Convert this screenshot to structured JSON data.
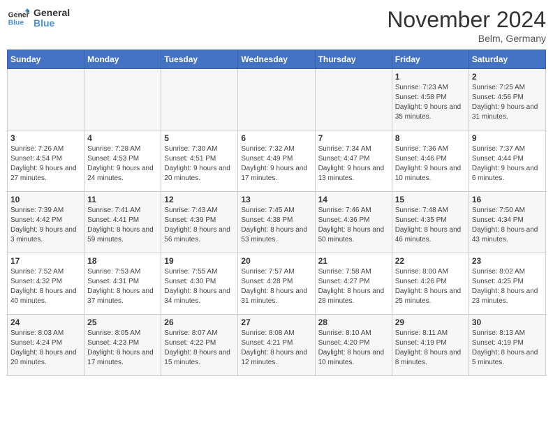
{
  "header": {
    "logo_line1": "General",
    "logo_line2": "Blue",
    "month_title": "November 2024",
    "location": "Belm, Germany"
  },
  "weekdays": [
    "Sunday",
    "Monday",
    "Tuesday",
    "Wednesday",
    "Thursday",
    "Friday",
    "Saturday"
  ],
  "weeks": [
    [
      {
        "day": "",
        "info": ""
      },
      {
        "day": "",
        "info": ""
      },
      {
        "day": "",
        "info": ""
      },
      {
        "day": "",
        "info": ""
      },
      {
        "day": "",
        "info": ""
      },
      {
        "day": "1",
        "info": "Sunrise: 7:23 AM\nSunset: 4:58 PM\nDaylight: 9 hours and 35 minutes."
      },
      {
        "day": "2",
        "info": "Sunrise: 7:25 AM\nSunset: 4:56 PM\nDaylight: 9 hours and 31 minutes."
      }
    ],
    [
      {
        "day": "3",
        "info": "Sunrise: 7:26 AM\nSunset: 4:54 PM\nDaylight: 9 hours and 27 minutes."
      },
      {
        "day": "4",
        "info": "Sunrise: 7:28 AM\nSunset: 4:53 PM\nDaylight: 9 hours and 24 minutes."
      },
      {
        "day": "5",
        "info": "Sunrise: 7:30 AM\nSunset: 4:51 PM\nDaylight: 9 hours and 20 minutes."
      },
      {
        "day": "6",
        "info": "Sunrise: 7:32 AM\nSunset: 4:49 PM\nDaylight: 9 hours and 17 minutes."
      },
      {
        "day": "7",
        "info": "Sunrise: 7:34 AM\nSunset: 4:47 PM\nDaylight: 9 hours and 13 minutes."
      },
      {
        "day": "8",
        "info": "Sunrise: 7:36 AM\nSunset: 4:46 PM\nDaylight: 9 hours and 10 minutes."
      },
      {
        "day": "9",
        "info": "Sunrise: 7:37 AM\nSunset: 4:44 PM\nDaylight: 9 hours and 6 minutes."
      }
    ],
    [
      {
        "day": "10",
        "info": "Sunrise: 7:39 AM\nSunset: 4:42 PM\nDaylight: 9 hours and 3 minutes."
      },
      {
        "day": "11",
        "info": "Sunrise: 7:41 AM\nSunset: 4:41 PM\nDaylight: 8 hours and 59 minutes."
      },
      {
        "day": "12",
        "info": "Sunrise: 7:43 AM\nSunset: 4:39 PM\nDaylight: 8 hours and 56 minutes."
      },
      {
        "day": "13",
        "info": "Sunrise: 7:45 AM\nSunset: 4:38 PM\nDaylight: 8 hours and 53 minutes."
      },
      {
        "day": "14",
        "info": "Sunrise: 7:46 AM\nSunset: 4:36 PM\nDaylight: 8 hours and 50 minutes."
      },
      {
        "day": "15",
        "info": "Sunrise: 7:48 AM\nSunset: 4:35 PM\nDaylight: 8 hours and 46 minutes."
      },
      {
        "day": "16",
        "info": "Sunrise: 7:50 AM\nSunset: 4:34 PM\nDaylight: 8 hours and 43 minutes."
      }
    ],
    [
      {
        "day": "17",
        "info": "Sunrise: 7:52 AM\nSunset: 4:32 PM\nDaylight: 8 hours and 40 minutes."
      },
      {
        "day": "18",
        "info": "Sunrise: 7:53 AM\nSunset: 4:31 PM\nDaylight: 8 hours and 37 minutes."
      },
      {
        "day": "19",
        "info": "Sunrise: 7:55 AM\nSunset: 4:30 PM\nDaylight: 8 hours and 34 minutes."
      },
      {
        "day": "20",
        "info": "Sunrise: 7:57 AM\nSunset: 4:28 PM\nDaylight: 8 hours and 31 minutes."
      },
      {
        "day": "21",
        "info": "Sunrise: 7:58 AM\nSunset: 4:27 PM\nDaylight: 8 hours and 28 minutes."
      },
      {
        "day": "22",
        "info": "Sunrise: 8:00 AM\nSunset: 4:26 PM\nDaylight: 8 hours and 25 minutes."
      },
      {
        "day": "23",
        "info": "Sunrise: 8:02 AM\nSunset: 4:25 PM\nDaylight: 8 hours and 23 minutes."
      }
    ],
    [
      {
        "day": "24",
        "info": "Sunrise: 8:03 AM\nSunset: 4:24 PM\nDaylight: 8 hours and 20 minutes."
      },
      {
        "day": "25",
        "info": "Sunrise: 8:05 AM\nSunset: 4:23 PM\nDaylight: 8 hours and 17 minutes."
      },
      {
        "day": "26",
        "info": "Sunrise: 8:07 AM\nSunset: 4:22 PM\nDaylight: 8 hours and 15 minutes."
      },
      {
        "day": "27",
        "info": "Sunrise: 8:08 AM\nSunset: 4:21 PM\nDaylight: 8 hours and 12 minutes."
      },
      {
        "day": "28",
        "info": "Sunrise: 8:10 AM\nSunset: 4:20 PM\nDaylight: 8 hours and 10 minutes."
      },
      {
        "day": "29",
        "info": "Sunrise: 8:11 AM\nSunset: 4:19 PM\nDaylight: 8 hours and 8 minutes."
      },
      {
        "day": "30",
        "info": "Sunrise: 8:13 AM\nSunset: 4:19 PM\nDaylight: 8 hours and 5 minutes."
      }
    ]
  ]
}
